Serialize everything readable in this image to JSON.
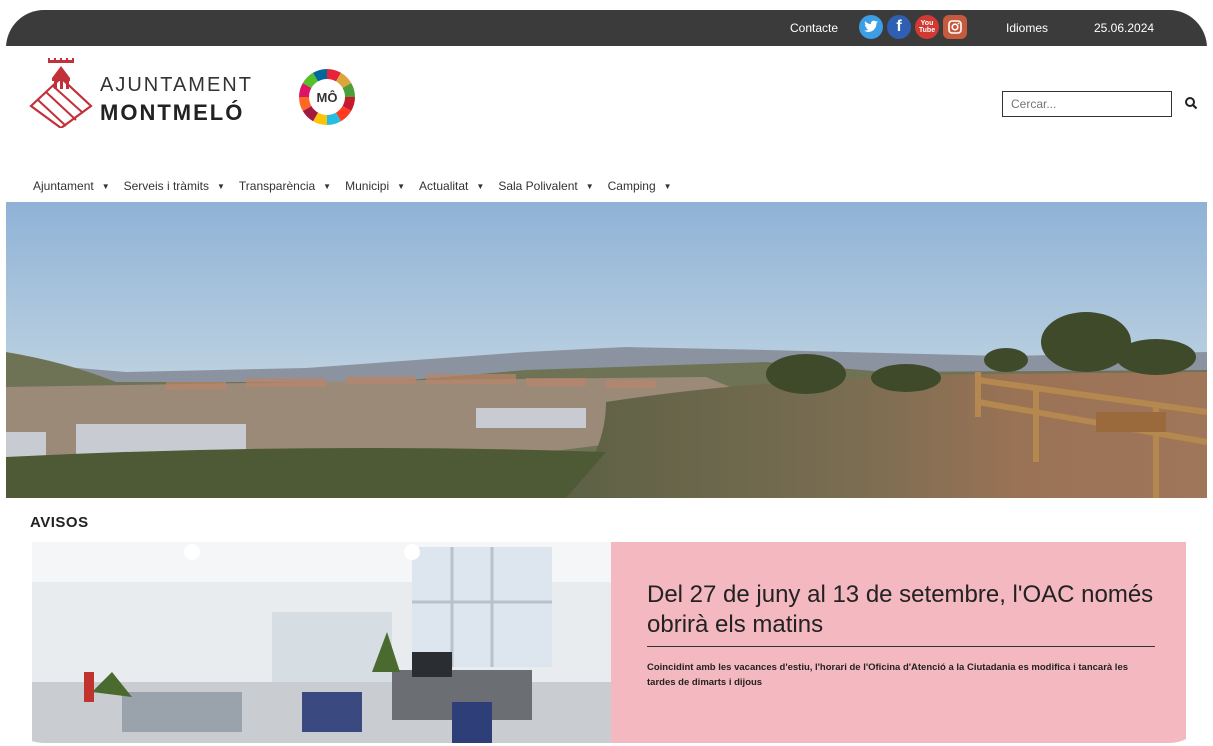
{
  "topbar": {
    "contact": "Contacte",
    "languages": "Idiomes",
    "date": "25.06.2024",
    "social": [
      {
        "icon": "twitter-icon",
        "color": "#3d9ee6",
        "glyph": "t"
      },
      {
        "icon": "facebook-icon",
        "color": "#2f5fb3",
        "glyph": "f"
      },
      {
        "icon": "youtube-icon",
        "color": "#d03a33",
        "glyph": "You\nTube"
      },
      {
        "icon": "instagram-icon",
        "color": "#c55a3c",
        "glyph": "◎"
      }
    ]
  },
  "brand": {
    "line1": "AJUNTAMENT",
    "line2": "MONTMELÓ",
    "badge": "MÔ"
  },
  "search": {
    "placeholder": "Cercar..."
  },
  "nav": {
    "items": [
      {
        "label": "Ajuntament"
      },
      {
        "label": "Serveis i tràmits"
      },
      {
        "label": "Transparència"
      },
      {
        "label": "Municipi"
      },
      {
        "label": "Actualitat"
      },
      {
        "label": "Sala Polivalent"
      },
      {
        "label": "Camping"
      }
    ]
  },
  "section": {
    "title": "AVISOS"
  },
  "notice": {
    "title": "Del 27 de juny al 13 de setembre, l'OAC només obrirà els matins",
    "description": "Coincidint amb les vacances d'estiu, l'horari de l'Oficina d'Atenció a la Ciutadania es modifica i tancarà les tardes de dimarts i dijous",
    "panel_color": "#f4b8c0"
  }
}
